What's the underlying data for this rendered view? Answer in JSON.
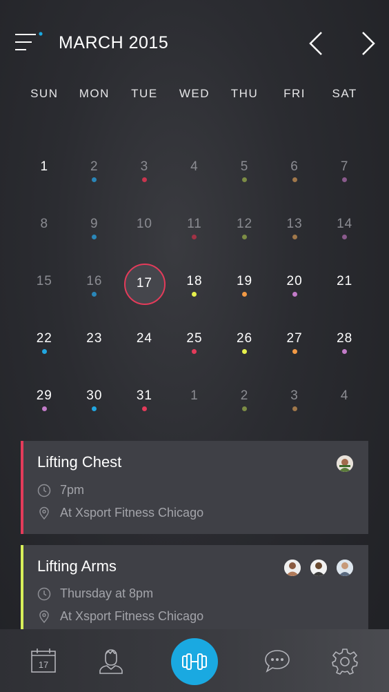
{
  "header": {
    "title": "MARCH 2015"
  },
  "weekdays": [
    "SUN",
    "MON",
    "TUE",
    "WED",
    "THU",
    "FRI",
    "SAT"
  ],
  "colors": {
    "accent": "#1aa9e1",
    "selected_ring": "#e43b5a",
    "blue": "#2a86b8",
    "red": "#c8354e",
    "olive": "#7c8c45",
    "brown": "#a0774a",
    "purple": "#8a5a8c",
    "yellow": "#e6f04c",
    "orange": "#f29a45",
    "pink": "#e25d6c",
    "cyan": "#21a6e0",
    "lilac": "#c27bc8",
    "lime": "#d8f05a"
  },
  "weeks": [
    [
      {
        "n": "1",
        "tone": "bright",
        "dot": null
      },
      {
        "n": "2",
        "tone": "dim",
        "dot": "#2a86b8"
      },
      {
        "n": "3",
        "tone": "dim",
        "dot": "#c8354e"
      },
      {
        "n": "4",
        "tone": "dim",
        "dot": null
      },
      {
        "n": "5",
        "tone": "dim",
        "dot": "#7c8c45"
      },
      {
        "n": "6",
        "tone": "dim",
        "dot": "#a0774a"
      },
      {
        "n": "7",
        "tone": "dim",
        "dot": "#8a5a8c"
      }
    ],
    [
      {
        "n": "8",
        "tone": "dim",
        "dot": null
      },
      {
        "n": "9",
        "tone": "dim",
        "dot": "#2a86b8"
      },
      {
        "n": "10",
        "tone": "dim",
        "dot": null
      },
      {
        "n": "11",
        "tone": "dim",
        "dot": "#a03245"
      },
      {
        "n": "12",
        "tone": "dim",
        "dot": "#7c8c45"
      },
      {
        "n": "13",
        "tone": "dim",
        "dot": "#a0774a"
      },
      {
        "n": "14",
        "tone": "dim",
        "dot": "#8a5a8c"
      }
    ],
    [
      {
        "n": "15",
        "tone": "dim",
        "dot": null
      },
      {
        "n": "16",
        "tone": "dim",
        "dot": "#2a86b8"
      },
      {
        "n": "17",
        "tone": "selected",
        "dot": null
      },
      {
        "n": "18",
        "tone": "bright",
        "dot": "#e6f04c"
      },
      {
        "n": "19",
        "tone": "bright",
        "dot": "#f29a45"
      },
      {
        "n": "20",
        "tone": "bright",
        "dot": "#c27bc8"
      },
      {
        "n": "21",
        "tone": "bright",
        "dot": null
      }
    ],
    [
      {
        "n": "22",
        "tone": "bright",
        "dot": "#21a6e0"
      },
      {
        "n": "23",
        "tone": "bright",
        "dot": null
      },
      {
        "n": "24",
        "tone": "bright",
        "dot": null
      },
      {
        "n": "25",
        "tone": "bright",
        "dot": "#e43b5a"
      },
      {
        "n": "26",
        "tone": "bright",
        "dot": "#e6f04c"
      },
      {
        "n": "27",
        "tone": "bright",
        "dot": "#f29a45"
      },
      {
        "n": "28",
        "tone": "bright",
        "dot": "#c27bc8"
      }
    ],
    [
      {
        "n": "29",
        "tone": "bright",
        "dot": "#c27bc8"
      },
      {
        "n": "30",
        "tone": "bright",
        "dot": "#21a6e0"
      },
      {
        "n": "31",
        "tone": "bright",
        "dot": "#e43b5a"
      },
      {
        "n": "1",
        "tone": "dim",
        "dot": null
      },
      {
        "n": "2",
        "tone": "dim",
        "dot": "#7c8c45"
      },
      {
        "n": "3",
        "tone": "dim",
        "dot": "#a0774a"
      },
      {
        "n": "4",
        "tone": "dim",
        "dot": null
      }
    ]
  ],
  "events": [
    {
      "title": "Lifting Chest",
      "time": "7pm",
      "location": "At Xsport Fitness Chicago",
      "stripe_color": "#e43b5a",
      "avatars": 1
    },
    {
      "title": "Lifting Arms",
      "time": "Thursday at 8pm",
      "location": "At Xsport Fitness Chicago",
      "stripe_color": "#d8f05a",
      "avatars": 3
    }
  ],
  "tabbar": {
    "calendar_day": "17",
    "items": [
      "calendar-icon",
      "profile-icon",
      "dumbbell-icon",
      "chat-icon",
      "settings-icon"
    ]
  }
}
